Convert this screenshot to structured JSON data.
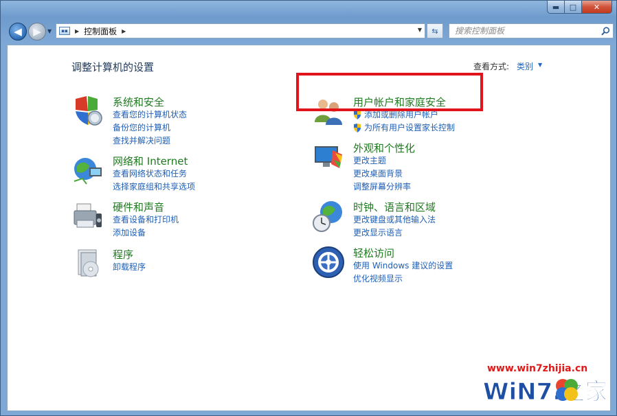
{
  "window": {
    "caption_buttons": {
      "minimize": "▬",
      "maximize": "□",
      "close": "✕"
    }
  },
  "navigation": {
    "back_icon": "back-arrow-icon",
    "forward_icon": "forward-arrow-icon",
    "breadcrumb": [
      "控制面板"
    ],
    "search_placeholder": "搜索控制面板"
  },
  "main": {
    "title": "调整计算机的设置",
    "view_by_label": "查看方式:",
    "view_by_value": "类别",
    "categories": [
      {
        "title": "系统和安全",
        "icon": "system-security-icon",
        "links": [
          "查看您的计算机状态",
          "备份您的计算机",
          "查找并解决问题"
        ]
      },
      {
        "title": "网络和 Internet",
        "icon": "network-internet-icon",
        "links": [
          "查看网络状态和任务",
          "选择家庭组和共享选项"
        ]
      },
      {
        "title": "硬件和声音",
        "icon": "hardware-sound-icon",
        "links": [
          "查看设备和打印机",
          "添加设备"
        ]
      },
      {
        "title": "程序",
        "icon": "programs-icon",
        "links": [
          "卸载程序"
        ]
      },
      {
        "title": "用户帐户和家庭安全",
        "icon": "user-accounts-icon",
        "links": [
          "添加或删除用户帐户",
          "为所有用户设置家长控制"
        ]
      },
      {
        "title": "外观和个性化",
        "icon": "appearance-icon",
        "links": [
          "更改主题",
          "更改桌面背景",
          "调整屏幕分辨率"
        ]
      },
      {
        "title": "时钟、语言和区域",
        "icon": "clock-language-region-icon",
        "links": [
          "更改键盘或其他输入法",
          "更改显示语言"
        ]
      },
      {
        "title": "轻松访问",
        "icon": "ease-of-access-icon",
        "links": [
          "使用 Windows 建议的设置",
          "优化视频显示"
        ]
      }
    ]
  },
  "watermark": {
    "url": "www.win7zhijia.cn",
    "logo_text": "WiN7.之家"
  },
  "colors": {
    "highlight": "#e0141a",
    "category_title": "#1e7a1e",
    "link": "#1f5fb5"
  }
}
